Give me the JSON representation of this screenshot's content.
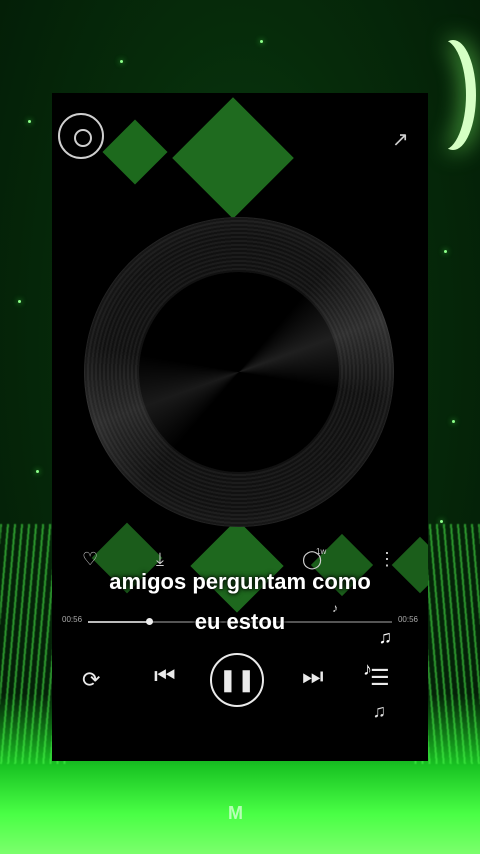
{
  "lyrics": {
    "line1": "amigos perguntam como",
    "line2": "eu estou"
  },
  "player": {
    "time_elapsed": "00:56",
    "time_total": "00:56",
    "progress": 0.2,
    "comment_count": "1w"
  },
  "icons": {
    "app_logo": "vinyl-logo-icon",
    "share": "share-icon",
    "like": "heart-icon",
    "download": "download-icon",
    "comment": "comment-icon",
    "more": "more-icon",
    "repeat": "repeat-icon",
    "previous": "previous-icon",
    "play_pause": "pause-icon",
    "next": "next-icon",
    "playlist": "playlist-icon"
  },
  "watermark": "M",
  "colors": {
    "accent_green": "#2bff2b",
    "diamond_green": "#1e681e"
  }
}
